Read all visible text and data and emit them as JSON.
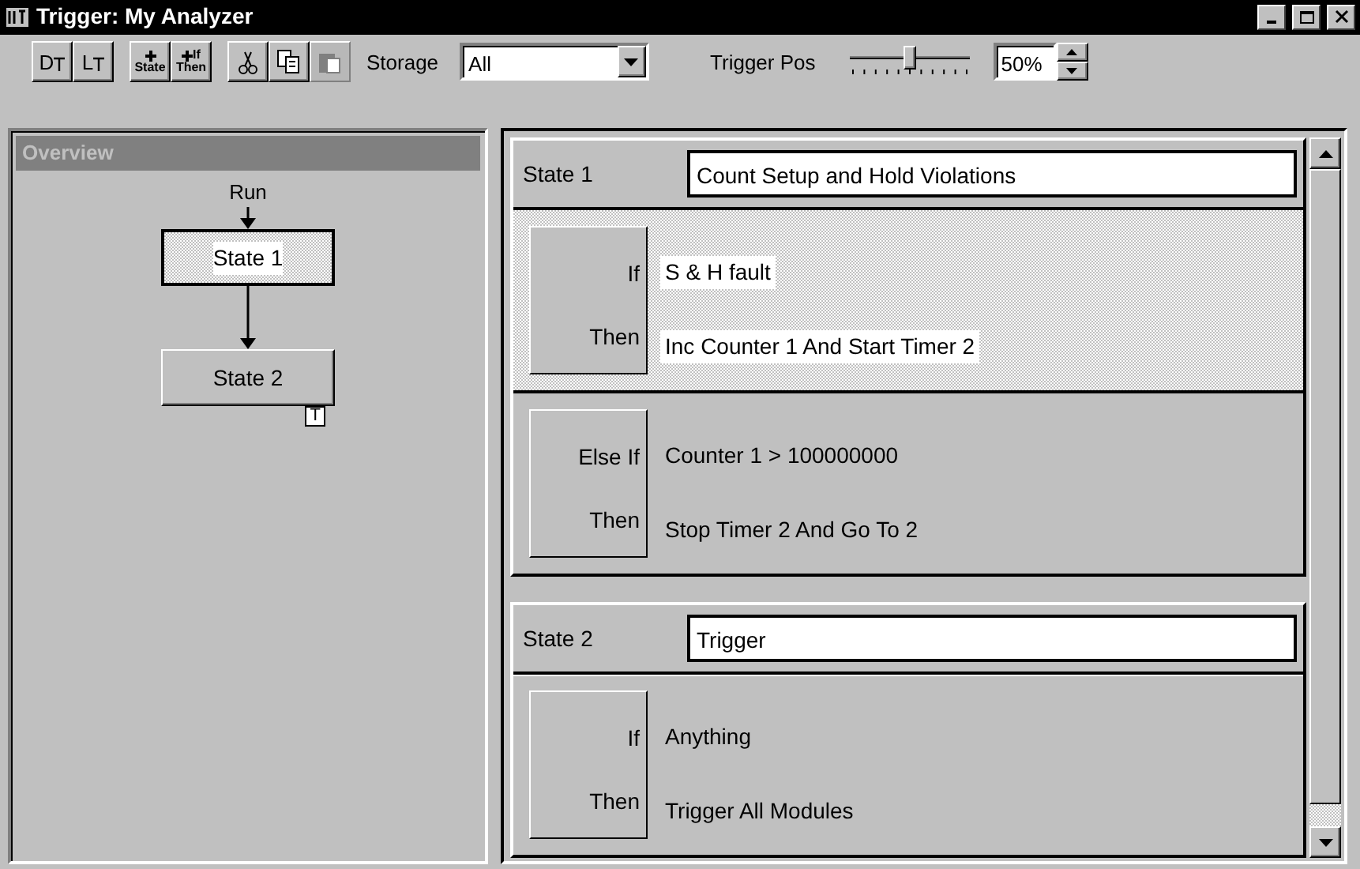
{
  "window": {
    "title": "Trigger: My Analyzer"
  },
  "toolbar": {
    "trigger_buttons": [
      {
        "label": "D"
      },
      {
        "label": "L"
      }
    ],
    "add_buttons": [
      {
        "caption": "State"
      },
      {
        "top": "If",
        "caption": "Then"
      }
    ],
    "edit_buttons": [
      {
        "kind": "cut",
        "disabled": false
      },
      {
        "kind": "copy",
        "disabled": false
      },
      {
        "kind": "paste",
        "disabled": true
      }
    ],
    "storage": {
      "label": "Storage",
      "value": "All"
    },
    "trigger_pos": {
      "label": "Trigger Pos",
      "level": 0.5,
      "value": "50%"
    }
  },
  "overview": {
    "title": "Overview",
    "start": "Run",
    "states": [
      {
        "label": "State 1",
        "selected": true
      },
      {
        "label": "State 2",
        "selected": false,
        "trigger": "T"
      }
    ]
  },
  "states": [
    {
      "label": "State 1",
      "name": "Count Setup and Hold Violations",
      "branches": [
        {
          "selected": true,
          "clauses": [
            {
              "keyword": "If",
              "text": "S & H fault"
            },
            {
              "keyword": "Then",
              "text": "Inc Counter 1 And Start Timer 2"
            }
          ]
        },
        {
          "selected": false,
          "clauses": [
            {
              "keyword": "Else If",
              "text": "Counter 1 > 100000000"
            },
            {
              "keyword": "Then",
              "text": "Stop Timer 2 And Go To 2"
            }
          ]
        }
      ]
    },
    {
      "label": "State 2",
      "name": "Trigger",
      "branches": [
        {
          "selected": false,
          "clauses": [
            {
              "keyword": "If",
              "text": "Anything"
            },
            {
              "keyword": "Then",
              "text": "Trigger All Modules"
            }
          ]
        }
      ]
    }
  ]
}
